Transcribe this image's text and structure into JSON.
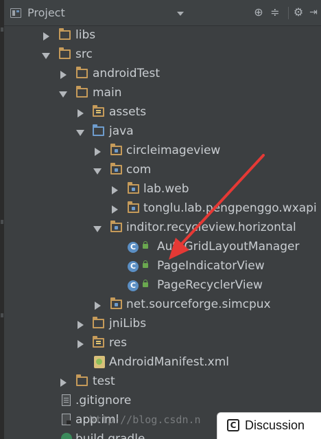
{
  "panel": {
    "title": "Project",
    "view_icon": "project-view-icon",
    "actions": [
      "locate-icon",
      "collapse-all-icon",
      "gear-icon",
      "hide-panel-icon"
    ]
  },
  "tree": {
    "rows": [
      {
        "label": "libs",
        "icon": "folder-icon"
      },
      {
        "label": "src",
        "icon": "folder-icon"
      },
      {
        "label": "androidTest",
        "icon": "folder-icon"
      },
      {
        "label": "main",
        "icon": "folder-icon"
      },
      {
        "label": "assets",
        "icon": "assets-folder-icon"
      },
      {
        "label": "java",
        "icon": "source-folder-icon"
      },
      {
        "label": "circleimageview",
        "icon": "package-icon"
      },
      {
        "label": "com",
        "icon": "package-icon"
      },
      {
        "label": "lab.web",
        "icon": "package-icon"
      },
      {
        "label": "tonglu.lab.pengpenggo.wxapi",
        "icon": "package-icon"
      },
      {
        "label": "inditor.recycleview.horizontal",
        "icon": "package-icon"
      },
      {
        "label": "AutoGridLayoutManager",
        "icon": "class-icon"
      },
      {
        "label": "PageIndicatorView",
        "icon": "class-icon"
      },
      {
        "label": "PageRecyclerView",
        "icon": "class-icon"
      },
      {
        "label": "net.sourceforge.simcpux",
        "icon": "package-icon"
      },
      {
        "label": "jniLibs",
        "icon": "folder-icon"
      },
      {
        "label": "res",
        "icon": "resources-folder-icon"
      },
      {
        "label": "AndroidManifest.xml",
        "icon": "xml-file-icon"
      },
      {
        "label": "test",
        "icon": "folder-icon"
      },
      {
        "label": ".gitignore",
        "icon": "text-file-icon"
      },
      {
        "label": "app.iml",
        "icon": "iml-file-icon"
      },
      {
        "label": "build.gradle",
        "icon": "gradle-icon"
      }
    ]
  },
  "watermark": "http://blog.csdn.n",
  "discussion_button": {
    "label": "Discussion",
    "icon": "discussion-icon"
  },
  "annotation": {
    "color": "#e53935"
  }
}
